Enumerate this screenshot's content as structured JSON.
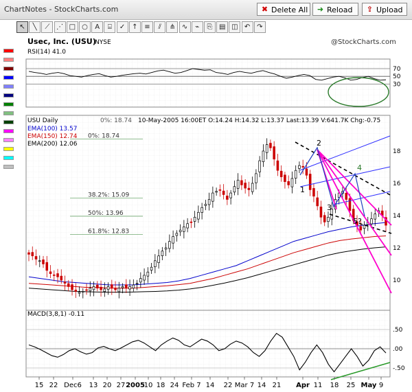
{
  "app": {
    "title": "ChartNotes - StockCharts.com",
    "delete_all": "Delete All",
    "reload": "Reload",
    "upload": "Upload"
  },
  "tools": [
    "pointer-tool",
    "line-tool",
    "trendline-tool",
    "fan-tool",
    "rectangle-tool",
    "circle-tool",
    "text-tool",
    "callout-tool",
    "stamp-tool",
    "arrow-tool",
    "fibonacci-tool",
    "channel-tool",
    "andrews-pitchfork-tool",
    "cycle-tool",
    "zigzag-tool",
    "copy-tool",
    "paste-tool",
    "send-back-tool",
    "undo-tool",
    "redo-tool"
  ],
  "palette_colors": [
    "#ff0000",
    "#ff8080",
    "#800000",
    "#0000ff",
    "#8080ff",
    "#000080",
    "#008000",
    "#80c080",
    "#004000",
    "#ff00ff",
    "#ff80ff",
    "#ffff00",
    "#00ffff",
    "#c0c0c0"
  ],
  "header": {
    "symbol_label": "Usec, Inc. (USU)",
    "exchange": "NYSE",
    "watermark": "@StockCharts.com"
  },
  "rsi": {
    "label": "RSI(14) 41.0",
    "levels": [
      70,
      50,
      30
    ]
  },
  "price": {
    "label": "USU Daily",
    "legend": [
      {
        "text": "EMA(100) 13.57",
        "color": "#0000cc"
      },
      {
        "text": "EMA(150) 12.74",
        "color": "#cc0000"
      },
      {
        "text": "EMA(200) 12.06",
        "color": "#000000"
      }
    ],
    "quote": "10-May-2005 16:00ET O:14.24 H:14.32 L:13.37 Last:13.39 V:641.7K Chg:-0.75",
    "y_ticks": [
      18,
      16,
      14,
      12,
      10
    ],
    "fib_levels": [
      {
        "label": "0%: 18.74",
        "value": 18.74
      },
      {
        "label": "38.2%: 15.09",
        "value": 15.09
      },
      {
        "label": "50%: 13.96",
        "value": 13.96
      },
      {
        "label": "61.8%: 12.83",
        "value": 12.83
      }
    ],
    "wave_labels": [
      "1",
      "2",
      "3",
      "4",
      "5?"
    ]
  },
  "macd": {
    "label": "MACD(3,8,1) -0.11",
    "y_ticks": [
      ".50",
      ".00",
      "-.50"
    ]
  },
  "x_axis": {
    "labels": [
      "15",
      "22",
      "Dec6",
      "13",
      "20",
      "27",
      "2005",
      "10",
      "18",
      "24",
      "Feb 7",
      "14",
      "22",
      "Mar 7",
      "14",
      "21",
      "Apr",
      "11",
      "18",
      "25",
      "May",
      "9"
    ]
  },
  "chart_data": {
    "type": "candlestick",
    "title": "Usec, Inc. (USU)",
    "subtitle": "USU Daily",
    "ylim": [
      9,
      19.3
    ],
    "x_start": "15-Nov-2004",
    "x_end": "10-May-2005",
    "close": [
      11.6,
      11.5,
      11.3,
      11.2,
      11.0,
      10.6,
      10.4,
      10.3,
      10.2,
      10.0,
      9.8,
      9.6,
      9.4,
      9.3,
      9.25,
      9.3,
      9.4,
      9.5,
      9.6,
      9.5,
      9.4,
      9.45,
      9.6,
      9.5,
      9.4,
      9.5,
      9.6,
      9.5,
      9.6,
      9.7,
      9.8,
      10.1,
      10.3,
      10.5,
      10.8,
      11.2,
      11.5,
      11.8,
      12.0,
      12.4,
      12.7,
      12.9,
      13.1,
      13.3,
      13.5,
      13.6,
      13.9,
      14.2,
      14.5,
      14.7,
      15.0,
      15.4,
      15.5,
      15.6,
      15.3,
      15.0,
      15.4,
      15.8,
      16.2,
      15.9,
      15.7,
      15.6,
      16.0,
      16.6,
      17.4,
      18.0,
      18.4,
      18.2,
      17.5,
      16.8,
      16.4,
      16.1,
      15.9,
      16.3,
      16.8,
      17.1,
      17.0,
      16.5,
      15.6,
      15.2,
      14.6,
      13.9,
      13.6,
      13.9,
      14.4,
      15.0,
      15.4,
      15.5,
      15.0,
      14.3,
      13.7,
      13.4,
      13.1,
      13.4,
      13.6,
      13.8,
      14.1,
      14.3,
      14.0,
      13.4
    ],
    "ema100": [
      10.2,
      10.1,
      10.0,
      9.9,
      9.85,
      9.8,
      9.75,
      9.7,
      9.7,
      9.7,
      9.75,
      9.8,
      9.85,
      9.95,
      10.1,
      10.3,
      10.5,
      10.7,
      10.9,
      11.2,
      11.5,
      11.8,
      12.1,
      12.4,
      12.6,
      12.8,
      13.0,
      13.15,
      13.3,
      13.4,
      13.5,
      13.57
    ],
    "ema150": [
      9.8,
      9.75,
      9.7,
      9.65,
      9.6,
      9.55,
      9.55,
      9.5,
      9.5,
      9.5,
      9.55,
      9.6,
      9.65,
      9.72,
      9.8,
      9.95,
      10.1,
      10.3,
      10.5,
      10.7,
      10.95,
      11.2,
      11.45,
      11.7,
      11.9,
      12.1,
      12.3,
      12.45,
      12.55,
      12.62,
      12.7,
      12.74
    ],
    "ema200": [
      9.5,
      9.45,
      9.4,
      9.35,
      9.3,
      9.28,
      9.26,
      9.25,
      9.25,
      9.26,
      9.28,
      9.3,
      9.33,
      9.38,
      9.45,
      9.55,
      9.68,
      9.82,
      9.98,
      10.15,
      10.35,
      10.55,
      10.75,
      10.95,
      11.15,
      11.35,
      11.55,
      11.7,
      11.82,
      11.92,
      12.0,
      12.06
    ],
    "rsi": [
      63,
      60,
      58,
      55,
      58,
      60,
      57,
      52,
      50,
      48,
      52,
      55,
      57,
      52,
      48,
      50,
      53,
      55,
      57,
      58,
      56,
      60,
      64,
      66,
      62,
      58,
      60,
      65,
      70,
      68,
      66,
      67,
      60,
      58,
      55,
      60,
      63,
      60,
      58,
      62,
      65,
      60,
      56,
      50,
      45,
      48,
      52,
      55,
      52,
      42,
      40,
      44,
      48,
      50,
      46,
      40,
      42,
      47,
      50,
      44,
      40,
      41
    ],
    "macd": [
      0.1,
      0.05,
      -0.02,
      -0.1,
      -0.18,
      -0.22,
      -0.15,
      -0.05,
      0.0,
      -0.08,
      -0.14,
      -0.1,
      0.02,
      0.06,
      0.0,
      -0.05,
      0.02,
      0.1,
      0.18,
      0.22,
      0.15,
      0.05,
      -0.05,
      0.1,
      0.2,
      0.28,
      0.22,
      0.1,
      0.05,
      0.15,
      0.25,
      0.2,
      0.1,
      -0.05,
      0.0,
      0.12,
      0.2,
      0.15,
      0.05,
      -0.1,
      -0.2,
      -0.05,
      0.2,
      0.4,
      0.3,
      0.05,
      -0.2,
      -0.55,
      -0.35,
      -0.1,
      0.1,
      -0.1,
      -0.4,
      -0.6,
      -0.4,
      -0.2,
      0.0,
      -0.2,
      -0.45,
      -0.3,
      -0.05,
      0.05,
      -0.11
    ]
  }
}
